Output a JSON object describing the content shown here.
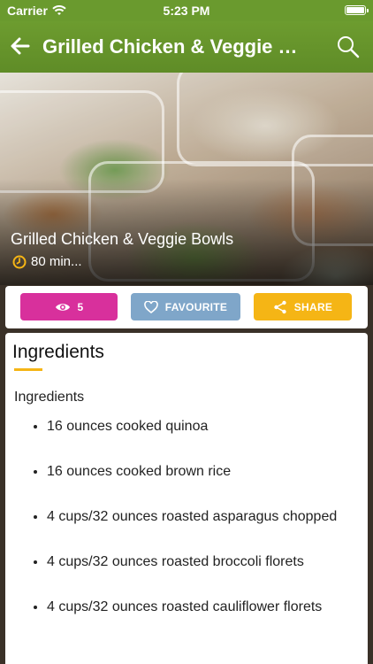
{
  "status_bar": {
    "carrier": "Carrier",
    "time": "5:23 PM"
  },
  "navbar": {
    "title": "Grilled Chicken & Veggie B..."
  },
  "hero": {
    "recipe_name": "Grilled Chicken & Veggie Bowls",
    "duration": "80 min..."
  },
  "actions": {
    "views_count": "5",
    "favourite_label": "FAVOURITE",
    "share_label": "SHARE"
  },
  "ingredients": {
    "heading": "Ingredients",
    "subheading": "Ingredients",
    "items": [
      "16 ounces cooked quinoa",
      "16 ounces cooked brown rice",
      "4 cups/32 ounces roasted asparagus chopped",
      "4 cups/32 ounces roasted broccoli florets",
      "4 cups/32 ounces roasted cauliflower florets"
    ]
  },
  "colors": {
    "header_green": "#6a9a2e",
    "views_pink": "#d8309c",
    "favourite_blue": "#7fa6c9",
    "share_yellow": "#f5b515"
  }
}
